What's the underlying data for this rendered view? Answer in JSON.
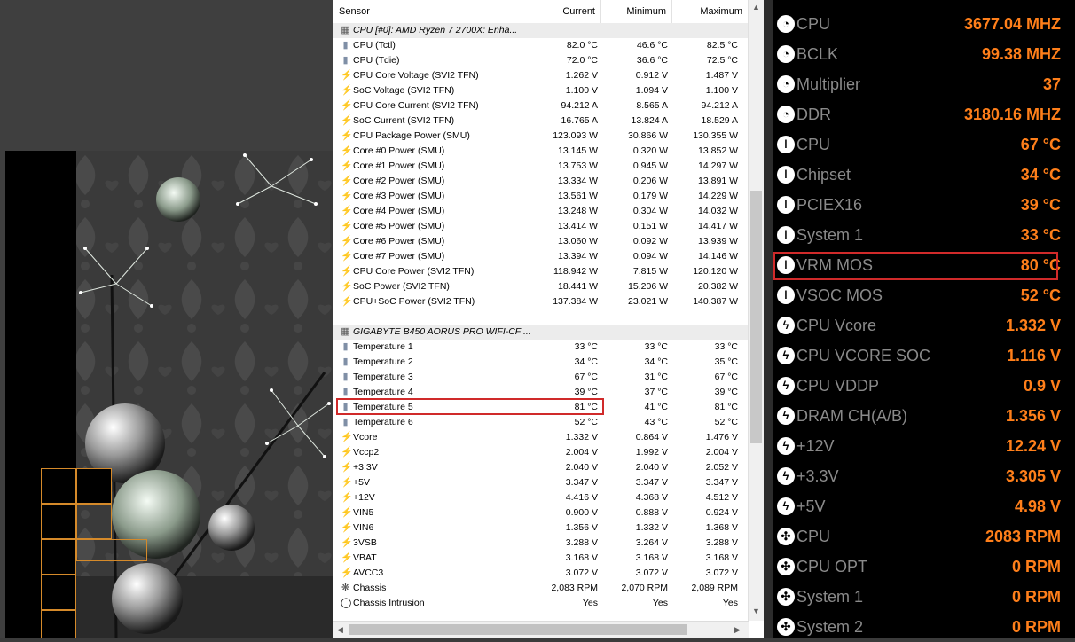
{
  "hwinfo": {
    "columns": [
      "Sensor",
      "Current",
      "Minimum",
      "Maximum"
    ],
    "rows": [
      {
        "type": "group",
        "icon": "chip",
        "name": "CPU [#0]: AMD Ryzen 7 2700X: Enha...",
        "cur": "",
        "min": "",
        "max": ""
      },
      {
        "type": "item",
        "icon": "therm",
        "name": "CPU (Tctl)",
        "cur": "82.0 °C",
        "min": "46.6 °C",
        "max": "82.5 °C"
      },
      {
        "type": "item",
        "icon": "therm",
        "name": "CPU (Tdie)",
        "cur": "72.0 °C",
        "min": "36.6 °C",
        "max": "72.5 °C"
      },
      {
        "type": "item",
        "icon": "bolt",
        "name": "CPU Core Voltage (SVI2 TFN)",
        "cur": "1.262 V",
        "min": "0.912 V",
        "max": "1.487 V"
      },
      {
        "type": "item",
        "icon": "bolt",
        "name": "SoC Voltage (SVI2 TFN)",
        "cur": "1.100 V",
        "min": "1.094 V",
        "max": "1.100 V"
      },
      {
        "type": "item",
        "icon": "bolt",
        "name": "CPU Core Current (SVI2 TFN)",
        "cur": "94.212 A",
        "min": "8.565 A",
        "max": "94.212 A"
      },
      {
        "type": "item",
        "icon": "bolt",
        "name": "SoC Current (SVI2 TFN)",
        "cur": "16.765 A",
        "min": "13.824 A",
        "max": "18.529 A"
      },
      {
        "type": "item",
        "icon": "bolt",
        "name": "CPU Package Power (SMU)",
        "cur": "123.093 W",
        "min": "30.866 W",
        "max": "130.355 W"
      },
      {
        "type": "item",
        "icon": "bolt",
        "name": "Core #0 Power (SMU)",
        "cur": "13.145 W",
        "min": "0.320 W",
        "max": "13.852 W"
      },
      {
        "type": "item",
        "icon": "bolt",
        "name": "Core #1 Power (SMU)",
        "cur": "13.753 W",
        "min": "0.945 W",
        "max": "14.297 W"
      },
      {
        "type": "item",
        "icon": "bolt",
        "name": "Core #2 Power (SMU)",
        "cur": "13.334 W",
        "min": "0.206 W",
        "max": "13.891 W"
      },
      {
        "type": "item",
        "icon": "bolt",
        "name": "Core #3 Power (SMU)",
        "cur": "13.561 W",
        "min": "0.179 W",
        "max": "14.229 W"
      },
      {
        "type": "item",
        "icon": "bolt",
        "name": "Core #4 Power (SMU)",
        "cur": "13.248 W",
        "min": "0.304 W",
        "max": "14.032 W"
      },
      {
        "type": "item",
        "icon": "bolt",
        "name": "Core #5 Power (SMU)",
        "cur": "13.414 W",
        "min": "0.151 W",
        "max": "14.417 W"
      },
      {
        "type": "item",
        "icon": "bolt",
        "name": "Core #6 Power (SMU)",
        "cur": "13.060 W",
        "min": "0.092 W",
        "max": "13.939 W"
      },
      {
        "type": "item",
        "icon": "bolt",
        "name": "Core #7 Power (SMU)",
        "cur": "13.394 W",
        "min": "0.094 W",
        "max": "14.146 W"
      },
      {
        "type": "item",
        "icon": "bolt",
        "name": "CPU Core Power (SVI2 TFN)",
        "cur": "118.942 W",
        "min": "7.815 W",
        "max": "120.120 W"
      },
      {
        "type": "item",
        "icon": "bolt",
        "name": "SoC Power (SVI2 TFN)",
        "cur": "18.441 W",
        "min": "15.206 W",
        "max": "20.382 W"
      },
      {
        "type": "item",
        "icon": "bolt",
        "name": "CPU+SoC Power (SVI2 TFN)",
        "cur": "137.384 W",
        "min": "23.021 W",
        "max": "140.387 W"
      },
      {
        "type": "blank",
        "icon": "",
        "name": "",
        "cur": "",
        "min": "",
        "max": ""
      },
      {
        "type": "group",
        "icon": "chip",
        "name": "GIGABYTE B450 AORUS PRO WIFI-CF ...",
        "cur": "",
        "min": "",
        "max": ""
      },
      {
        "type": "item",
        "icon": "therm",
        "name": "Temperature 1",
        "cur": "33 °C",
        "min": "33 °C",
        "max": "33 °C"
      },
      {
        "type": "item",
        "icon": "therm",
        "name": "Temperature 2",
        "cur": "34 °C",
        "min": "34 °C",
        "max": "35 °C"
      },
      {
        "type": "item",
        "icon": "therm",
        "name": "Temperature 3",
        "cur": "67 °C",
        "min": "31 °C",
        "max": "67 °C"
      },
      {
        "type": "item",
        "icon": "therm",
        "name": "Temperature 4",
        "cur": "39 °C",
        "min": "37 °C",
        "max": "39 °C"
      },
      {
        "type": "item",
        "icon": "therm",
        "name": "Temperature 5",
        "cur": "81 °C",
        "min": "41 °C",
        "max": "81 °C"
      },
      {
        "type": "item",
        "icon": "therm",
        "name": "Temperature 6",
        "cur": "52 °C",
        "min": "43 °C",
        "max": "52 °C"
      },
      {
        "type": "item",
        "icon": "bolt",
        "name": "Vcore",
        "cur": "1.332 V",
        "min": "0.864 V",
        "max": "1.476 V"
      },
      {
        "type": "item",
        "icon": "bolt",
        "name": "Vccp2",
        "cur": "2.004 V",
        "min": "1.992 V",
        "max": "2.004 V"
      },
      {
        "type": "item",
        "icon": "bolt",
        "name": "+3.3V",
        "cur": "2.040 V",
        "min": "2.040 V",
        "max": "2.052 V"
      },
      {
        "type": "item",
        "icon": "bolt",
        "name": "+5V",
        "cur": "3.347 V",
        "min": "3.347 V",
        "max": "3.347 V"
      },
      {
        "type": "item",
        "icon": "bolt",
        "name": "+12V",
        "cur": "4.416 V",
        "min": "4.368 V",
        "max": "4.512 V"
      },
      {
        "type": "item",
        "icon": "bolt",
        "name": "VIN5",
        "cur": "0.900 V",
        "min": "0.888 V",
        "max": "0.924 V"
      },
      {
        "type": "item",
        "icon": "bolt",
        "name": "VIN6",
        "cur": "1.356 V",
        "min": "1.332 V",
        "max": "1.368 V"
      },
      {
        "type": "item",
        "icon": "bolt",
        "name": "3VSB",
        "cur": "3.288 V",
        "min": "3.264 V",
        "max": "3.288 V"
      },
      {
        "type": "item",
        "icon": "bolt",
        "name": "VBAT",
        "cur": "3.168 V",
        "min": "3.168 V",
        "max": "3.168 V"
      },
      {
        "type": "item",
        "icon": "bolt",
        "name": "AVCC3",
        "cur": "3.072 V",
        "min": "3.072 V",
        "max": "3.072 V"
      },
      {
        "type": "item",
        "icon": "fan",
        "name": "Chassis",
        "cur": "2,083 RPM",
        "min": "2,070 RPM",
        "max": "2,089 RPM"
      },
      {
        "type": "item",
        "icon": "ring",
        "name": "Chassis Intrusion",
        "cur": "Yes",
        "min": "Yes",
        "max": "Yes"
      }
    ]
  },
  "panel": {
    "accent": "#ff7f1a",
    "rows": [
      {
        "icon": "gauge",
        "label": "CPU",
        "value": "3677.04 MHZ"
      },
      {
        "icon": "gauge",
        "label": "BCLK",
        "value": "99.38 MHZ"
      },
      {
        "icon": "gauge",
        "label": "Multiplier",
        "value": "37"
      },
      {
        "icon": "gauge",
        "label": "DDR",
        "value": "3180.16 MHZ"
      },
      {
        "icon": "thermometer",
        "label": "CPU",
        "value": "67 °C"
      },
      {
        "icon": "thermometer",
        "label": "Chipset",
        "value": "34 °C"
      },
      {
        "icon": "thermometer",
        "label": "PCIEX16",
        "value": "39 °C"
      },
      {
        "icon": "thermometer",
        "label": "System 1",
        "value": "33 °C"
      },
      {
        "icon": "thermometer",
        "label": "VRM MOS",
        "value": "80 °C"
      },
      {
        "icon": "thermometer",
        "label": "VSOC MOS",
        "value": "52 °C"
      },
      {
        "icon": "bolt",
        "label": "CPU Vcore",
        "value": "1.332 V"
      },
      {
        "icon": "bolt",
        "label": "CPU VCORE SOC",
        "value": "1.116 V"
      },
      {
        "icon": "bolt",
        "label": "CPU VDDP",
        "value": "0.9 V"
      },
      {
        "icon": "bolt",
        "label": "DRAM CH(A/B)",
        "value": "1.356 V"
      },
      {
        "icon": "bolt",
        "label": "+12V",
        "value": "12.24 V"
      },
      {
        "icon": "bolt",
        "label": "+3.3V",
        "value": "3.305 V"
      },
      {
        "icon": "bolt",
        "label": "+5V",
        "value": "4.98 V"
      },
      {
        "icon": "fan",
        "label": "CPU",
        "value": "2083 RPM"
      },
      {
        "icon": "fan",
        "label": "CPU OPT",
        "value": "0 RPM"
      },
      {
        "icon": "fan",
        "label": "System 1",
        "value": "0 RPM"
      },
      {
        "icon": "fan",
        "label": "System 2",
        "value": "0 RPM"
      }
    ]
  }
}
